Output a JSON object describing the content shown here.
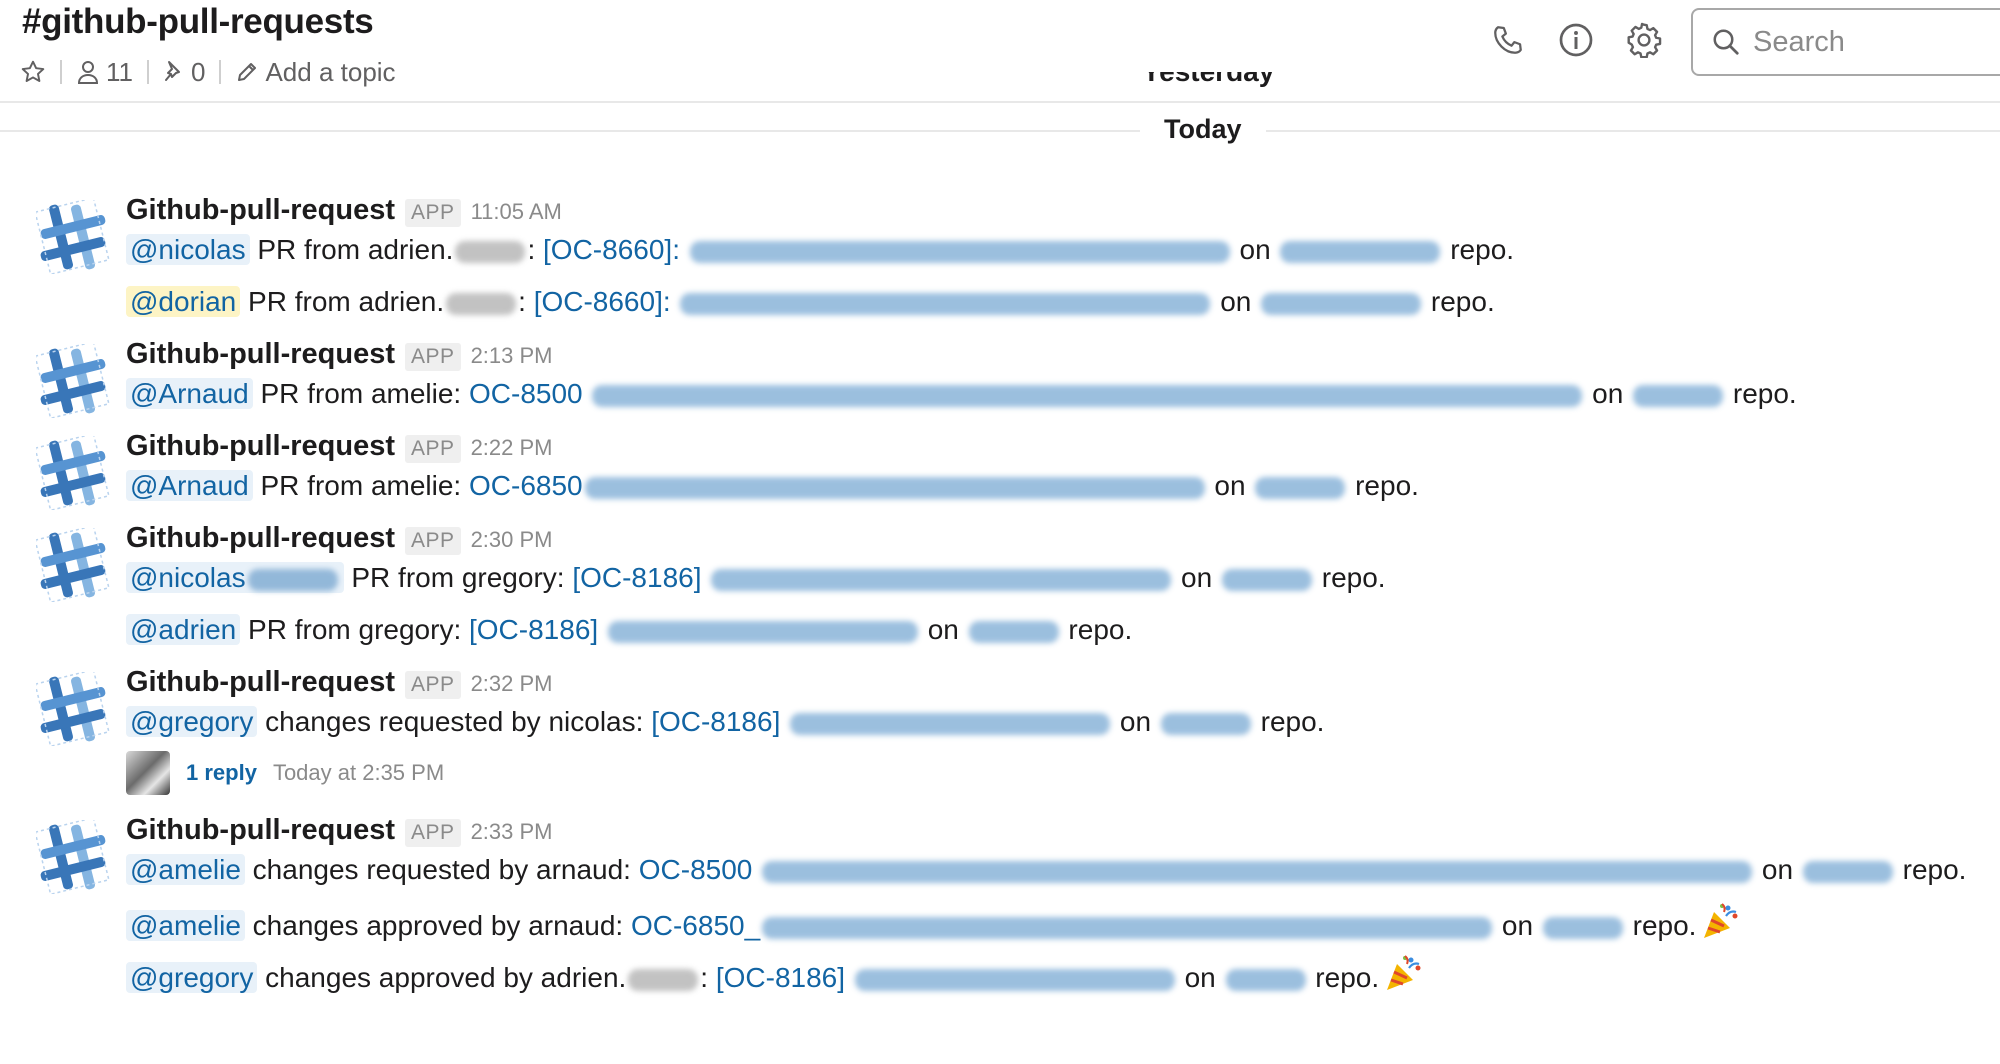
{
  "channel": {
    "title": "#github-pull-requests",
    "members": "11",
    "pins": "0",
    "topic_label": "Add a topic"
  },
  "header_icons": [
    "phone-icon",
    "info-icon",
    "gear-icon"
  ],
  "search": {
    "placeholder": "Search"
  },
  "dividers": {
    "yesterday": "Yesterday",
    "today": "Today"
  },
  "colors": {
    "link": "#1264a3",
    "mention_bg": "#e8f1f9",
    "highlight_bg": "#fdf4c5"
  },
  "messages": [
    {
      "author": "Github-pull-request",
      "badge": "APP",
      "time": "11:05 AM",
      "lines": [
        {
          "mention": "@nicolas",
          "text": " PR from adrien.",
          "sep": ": ",
          "link": "[OC-8660]: ",
          "on": " on ",
          "repo": " repo."
        },
        {
          "mention": "@dorian",
          "text": " PR from adrien.",
          "sep": ": ",
          "link": "[OC-8660]: ",
          "on": " on ",
          "repo": " repo."
        }
      ]
    },
    {
      "author": "Github-pull-request",
      "badge": "APP",
      "time": "2:13 PM",
      "lines": [
        {
          "mention": "@Arnaud",
          "text": " PR from amelie: ",
          "link": "OC-8500 ",
          "on": " on ",
          "repo": " repo."
        }
      ]
    },
    {
      "author": "Github-pull-request",
      "badge": "APP",
      "time": "2:22 PM",
      "lines": [
        {
          "mention": "@Arnaud",
          "text": " PR from amelie: ",
          "link": "OC-6850",
          "on": " on ",
          "repo": " repo."
        }
      ]
    },
    {
      "author": "Github-pull-request",
      "badge": "APP",
      "time": "2:30 PM",
      "lines": [
        {
          "mention": "@nicolas",
          "text": " PR from gregory: ",
          "link": "[OC-8186] ",
          "on": " on ",
          "repo": " repo."
        },
        {
          "mention": "@adrien",
          "text": " PR from gregory: ",
          "link": "[OC-8186] ",
          "on": " on ",
          "repo": " repo."
        }
      ]
    },
    {
      "author": "Github-pull-request",
      "badge": "APP",
      "time": "2:32 PM",
      "lines": [
        {
          "mention": "@gregory",
          "text": " changes requested by nicolas: ",
          "link": "[OC-8186] ",
          "on": " on ",
          "repo": " repo."
        }
      ],
      "reply": {
        "count": "1 reply",
        "time": "Today at 2:35 PM"
      }
    },
    {
      "author": "Github-pull-request",
      "badge": "APP",
      "time": "2:33 PM",
      "lines": [
        {
          "mention": "@amelie",
          "text": " changes requested by arnaud: ",
          "link": "OC-8500 ",
          "on": " on ",
          "repo": " repo."
        },
        {
          "mention": "@amelie",
          "text": " changes approved by arnaud: ",
          "link": "OC-6850_",
          "on": " on ",
          "repo": " repo."
        },
        {
          "mention": "@gregory",
          "text": " changes approved by adrien.",
          "sep": ": ",
          "link": "[OC-8186] ",
          "on": " on ",
          "repo": " repo."
        }
      ]
    }
  ]
}
